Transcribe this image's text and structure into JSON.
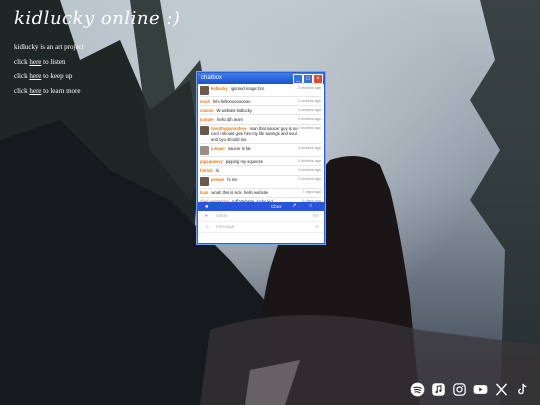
{
  "site": {
    "title": "kidlucky online :)",
    "lines": [
      {
        "a": "kidlucky is an art project",
        "link": "",
        "b": ""
      },
      {
        "a": "click ",
        "link": "here",
        "b": " to listen"
      },
      {
        "a": "click ",
        "link": "here",
        "b": " to keep up"
      },
      {
        "a": "click ",
        "link": "here",
        "b": " to learn more"
      }
    ]
  },
  "chatbox": {
    "title": "chatbox",
    "messages": [
      {
        "name": "kidlucky",
        "text": "ignored magic bro",
        "time": "2 months ago",
        "avatar": true
      },
      {
        "name": "noah",
        "text": "hihi helloooooooooo",
        "time": "2 months ago",
        "avatar": false
      },
      {
        "name": "saucer",
        "text": "W website kidlucky",
        "time": "2 months ago",
        "avatar": false
      },
      {
        "name": "juniper",
        "text": "hello dih team",
        "time": "2 months ago",
        "avatar": false
      },
      {
        "name": "timothygunnafore",
        "text": "man that saucer guy is so cool i should give him my life savings and soul and oyu should too",
        "time": "2 months ago",
        "avatar": true
      },
      {
        "name": "juniper",
        "text": "saucer is fat",
        "time": "2 months ago",
        "avatar": true
      },
      {
        "name": "pipsqueezy",
        "text": "pipping my squeeze",
        "time": "2 months ago",
        "avatar": false
      },
      {
        "name": "fatrick",
        "text": "hi",
        "time": "2 months ago",
        "avatar": false
      },
      {
        "name": "preeze",
        "text": "hi me",
        "time": "2 months ago",
        "avatar": true
      },
      {
        "name": "liam",
        "text": "woah this is sick. hello website",
        "time": "7 days ago",
        "avatar": false
      },
      {
        "name": "died yesterday",
        "text": "tuff Website, lucky kid",
        "time": "6 days ago",
        "avatar": false
      }
    ],
    "bar_label": "Cbox",
    "name_placeholder": "name",
    "message_placeholder": "message",
    "name_counter": "50",
    "message_counter": "0"
  },
  "social": [
    "spotify-icon",
    "apple-music-icon",
    "instagram-icon",
    "youtube-icon",
    "x-icon",
    "tiktok-icon"
  ]
}
